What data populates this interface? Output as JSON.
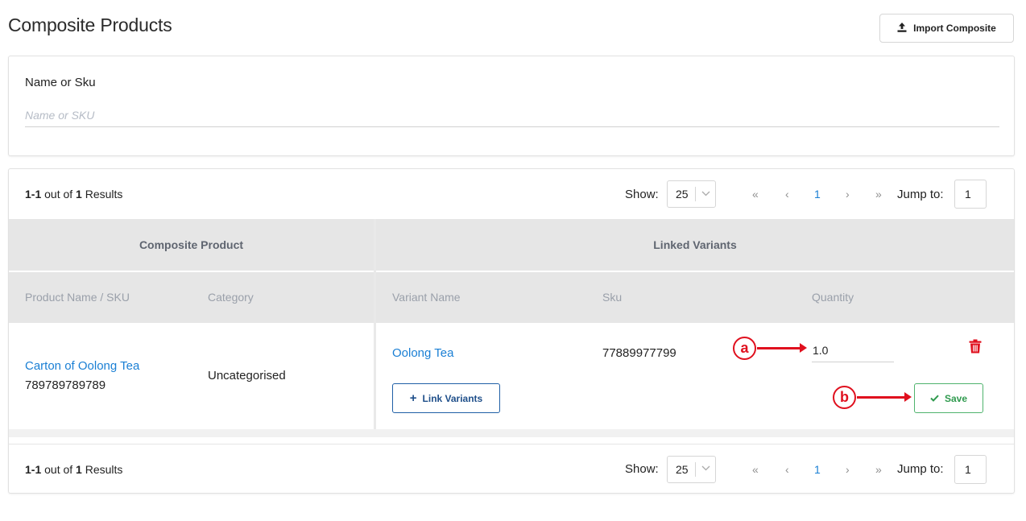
{
  "page": {
    "title": "Composite Products",
    "import_button_label": "Import Composite"
  },
  "filter": {
    "label": "Name or Sku",
    "placeholder": "Name or SKU",
    "value": ""
  },
  "pagination": {
    "range": "1-1",
    "out_of_text": " out of ",
    "total": "1",
    "results_text": " Results",
    "show_label": "Show:",
    "page_size": "25",
    "first": "«",
    "prev": "‹",
    "current_page": "1",
    "next": "›",
    "last": "»",
    "jump_label": "Jump to:",
    "jump_value": "1"
  },
  "table": {
    "group_headers": {
      "composite": "Composite Product",
      "linked": "Linked Variants"
    },
    "columns": {
      "product": "Product Name / SKU",
      "category": "Category",
      "variant_name": "Variant Name",
      "sku": "Sku",
      "quantity": "Quantity"
    },
    "rows": [
      {
        "product_name": "Carton of Oolong Tea",
        "product_sku": "789789789789",
        "category": "Uncategorised",
        "variants": [
          {
            "name": "Oolong Tea",
            "sku": "77889977799",
            "quantity": "1.0"
          }
        ],
        "link_variants_label": "Link Variants",
        "save_label": "Save"
      }
    ]
  },
  "annotations": {
    "a": "a",
    "b": "b"
  },
  "colors": {
    "link": "#1a7fd4",
    "save_green": "#2f9a4e",
    "delete_red": "#e0101e",
    "annotation_red": "#e0101e",
    "header_gray": "#e6e6e6"
  },
  "icons": {
    "import": "upload-icon",
    "delete": "trash-icon",
    "link": "plus-icon",
    "save": "check-icon",
    "select": "chevron-down-icon"
  }
}
